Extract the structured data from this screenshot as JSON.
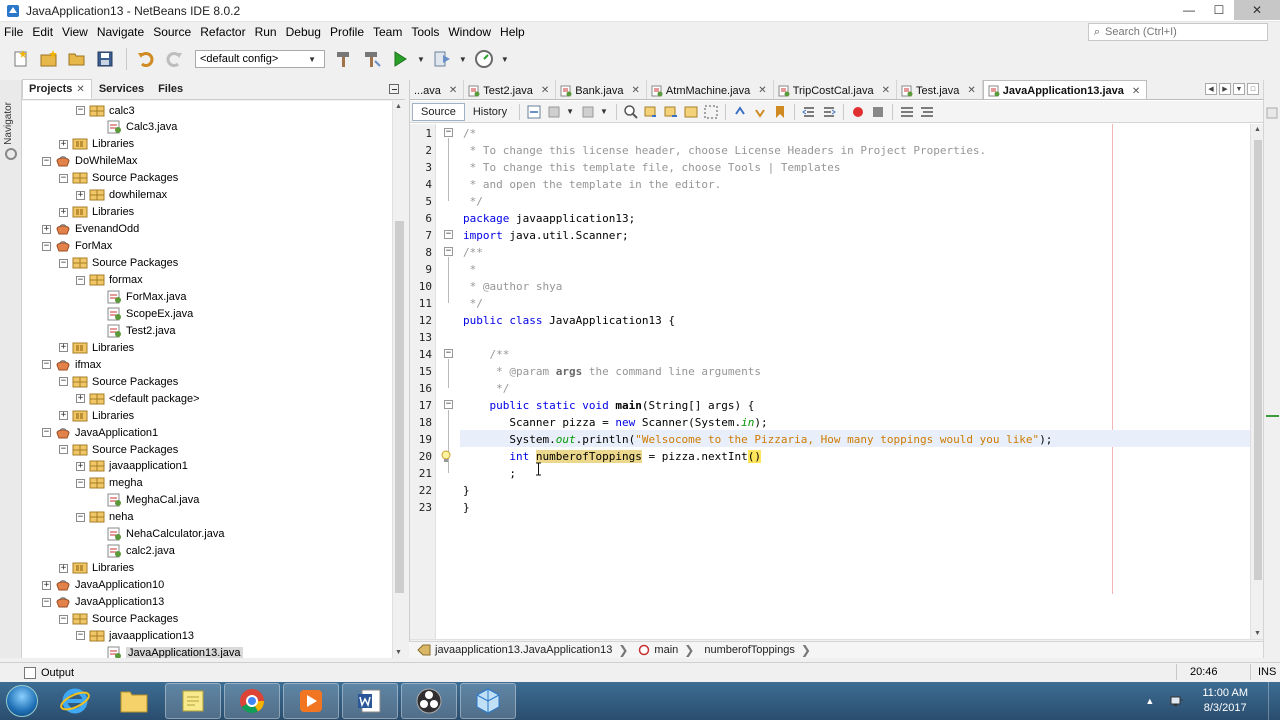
{
  "window": {
    "title": "JavaApplication13 - NetBeans IDE 8.0.2",
    "min": "—",
    "max": "☐",
    "close": "✕"
  },
  "menu": [
    "File",
    "Edit",
    "View",
    "Navigate",
    "Source",
    "Refactor",
    "Run",
    "Debug",
    "Profile",
    "Team",
    "Tools",
    "Window",
    "Help"
  ],
  "search": {
    "placeholder": "Search (Ctrl+I)"
  },
  "toolbar": {
    "config": "<default config>"
  },
  "navigator": {
    "label": "Navigator"
  },
  "project_tabs": {
    "projects": "Projects",
    "services": "Services",
    "files": "Files",
    "close": "✕"
  },
  "tree": [
    {
      "label": "calc3",
      "indent": 2,
      "toggle": "−",
      "icon": "package"
    },
    {
      "label": "Calc3.java",
      "indent": 3,
      "toggle": "",
      "icon": "java"
    },
    {
      "label": "Libraries",
      "indent": 1,
      "toggle": "+",
      "icon": "library"
    },
    {
      "label": "DoWhileMax",
      "indent": 0,
      "toggle": "−",
      "icon": "project"
    },
    {
      "label": "Source Packages",
      "indent": 1,
      "toggle": "−",
      "icon": "package"
    },
    {
      "label": "dowhilemax",
      "indent": 2,
      "toggle": "+",
      "icon": "package"
    },
    {
      "label": "Libraries",
      "indent": 1,
      "toggle": "+",
      "icon": "library"
    },
    {
      "label": "EvenandOdd",
      "indent": 0,
      "toggle": "+",
      "icon": "project"
    },
    {
      "label": "ForMax",
      "indent": 0,
      "toggle": "−",
      "icon": "project"
    },
    {
      "label": "Source Packages",
      "indent": 1,
      "toggle": "−",
      "icon": "package"
    },
    {
      "label": "formax",
      "indent": 2,
      "toggle": "−",
      "icon": "package"
    },
    {
      "label": "ForMax.java",
      "indent": 3,
      "toggle": "",
      "icon": "java"
    },
    {
      "label": "ScopeEx.java",
      "indent": 3,
      "toggle": "",
      "icon": "java"
    },
    {
      "label": "Test2.java",
      "indent": 3,
      "toggle": "",
      "icon": "java"
    },
    {
      "label": "Libraries",
      "indent": 1,
      "toggle": "+",
      "icon": "library"
    },
    {
      "label": "ifmax",
      "indent": 0,
      "toggle": "−",
      "icon": "project"
    },
    {
      "label": "Source Packages",
      "indent": 1,
      "toggle": "−",
      "icon": "package"
    },
    {
      "label": "<default package>",
      "indent": 2,
      "toggle": "+",
      "icon": "package"
    },
    {
      "label": "Libraries",
      "indent": 1,
      "toggle": "+",
      "icon": "library"
    },
    {
      "label": "JavaApplication1",
      "indent": 0,
      "toggle": "−",
      "icon": "project"
    },
    {
      "label": "Source Packages",
      "indent": 1,
      "toggle": "−",
      "icon": "package"
    },
    {
      "label": "javaapplication1",
      "indent": 2,
      "toggle": "+",
      "icon": "package"
    },
    {
      "label": "megha",
      "indent": 2,
      "toggle": "−",
      "icon": "package"
    },
    {
      "label": "MeghaCal.java",
      "indent": 3,
      "toggle": "",
      "icon": "java"
    },
    {
      "label": "neha",
      "indent": 2,
      "toggle": "−",
      "icon": "package"
    },
    {
      "label": "NehaCalculator.java",
      "indent": 3,
      "toggle": "",
      "icon": "java"
    },
    {
      "label": "calc2.java",
      "indent": 3,
      "toggle": "",
      "icon": "java"
    },
    {
      "label": "Libraries",
      "indent": 1,
      "toggle": "+",
      "icon": "library"
    },
    {
      "label": "JavaApplication10",
      "indent": 0,
      "toggle": "+",
      "icon": "project"
    },
    {
      "label": "JavaApplication13",
      "indent": 0,
      "toggle": "−",
      "icon": "project"
    },
    {
      "label": "Source Packages",
      "indent": 1,
      "toggle": "−",
      "icon": "package"
    },
    {
      "label": "javaapplication13",
      "indent": 2,
      "toggle": "−",
      "icon": "package"
    },
    {
      "label": "JavaApplication13.java",
      "indent": 3,
      "toggle": "",
      "icon": "java",
      "selected": true
    }
  ],
  "editor_tabs": [
    {
      "label": "...ava",
      "active": false
    },
    {
      "label": "Test2.java",
      "active": false
    },
    {
      "label": "Bank.java",
      "active": false
    },
    {
      "label": "AtmMachine.java",
      "active": false
    },
    {
      "label": "TripCostCal.java",
      "active": false
    },
    {
      "label": "Test.java",
      "active": false
    },
    {
      "label": "JavaApplication13.java",
      "active": true
    }
  ],
  "editor_tab_close": "✕",
  "editor_view": {
    "source": "Source",
    "history": "History"
  },
  "line_numbers": [
    "1",
    "2",
    "3",
    "4",
    "5",
    "6",
    "7",
    "8",
    "9",
    "10",
    "11",
    "12",
    "13",
    "14",
    "15",
    "16",
    "17",
    "18",
    "19",
    "20",
    "21",
    "22",
    "23"
  ],
  "code": {
    "l1": "/*",
    "l2": " * To change this license header, choose License Headers in Project Properties.",
    "l3": " * To change this template file, choose Tools | Templates",
    "l4": " * and open the template in the editor.",
    "l5": " */",
    "l6_kw": "package",
    "l6_rest": " javaapplication13;",
    "l7_kw": "import",
    "l7_rest": " java.util.Scanner;",
    "l8": "/**",
    "l9": " *",
    "l10": " * @author shya",
    "l11": " */",
    "l12_kw": "public class",
    "l12_name": " JavaApplication13",
    "l12_rest": " {",
    "l14": "    /**",
    "l15_a": "     * @param",
    "l15_b": " args",
    "l15_c": " the command line arguments",
    "l16": "     */",
    "l17_kw": "    public static void",
    "l17_name": " main",
    "l17_rest": "(String[] args) {",
    "l18_a": "       Scanner pizza = ",
    "l18_kw": "new",
    "l18_b": " Scanner(System.",
    "l18_in": "in",
    "l18_c": ");",
    "l19_a": "       System.",
    "l19_out": "out",
    "l19_b": ".println(",
    "l19_str": "\"Welsocome to the Pizzaria, How many toppings would you like\"",
    "l19_c": ");",
    "l20_kw": "       int",
    "l20_sp": " ",
    "l20_var": "numberofToppings",
    "l20_b": " = pizza.nextInt",
    "l20_paren": "()",
    "l21": "       ;",
    "l22": "}",
    "l23": "}"
  },
  "breadcrumb": {
    "class": "javaapplication13.JavaApplication13",
    "method": "main",
    "field": "numberofToppings"
  },
  "output": {
    "label": "Output"
  },
  "status": {
    "position": "20:46",
    "mode": "INS"
  },
  "clock": {
    "time": "11:00 AM",
    "date": "8/3/2017"
  },
  "colors": {
    "keyword": "#0000e6",
    "comment": "#969696",
    "string": "#ce7b00",
    "current_line": "#e9effa",
    "occurrence": "#ecd88c"
  }
}
